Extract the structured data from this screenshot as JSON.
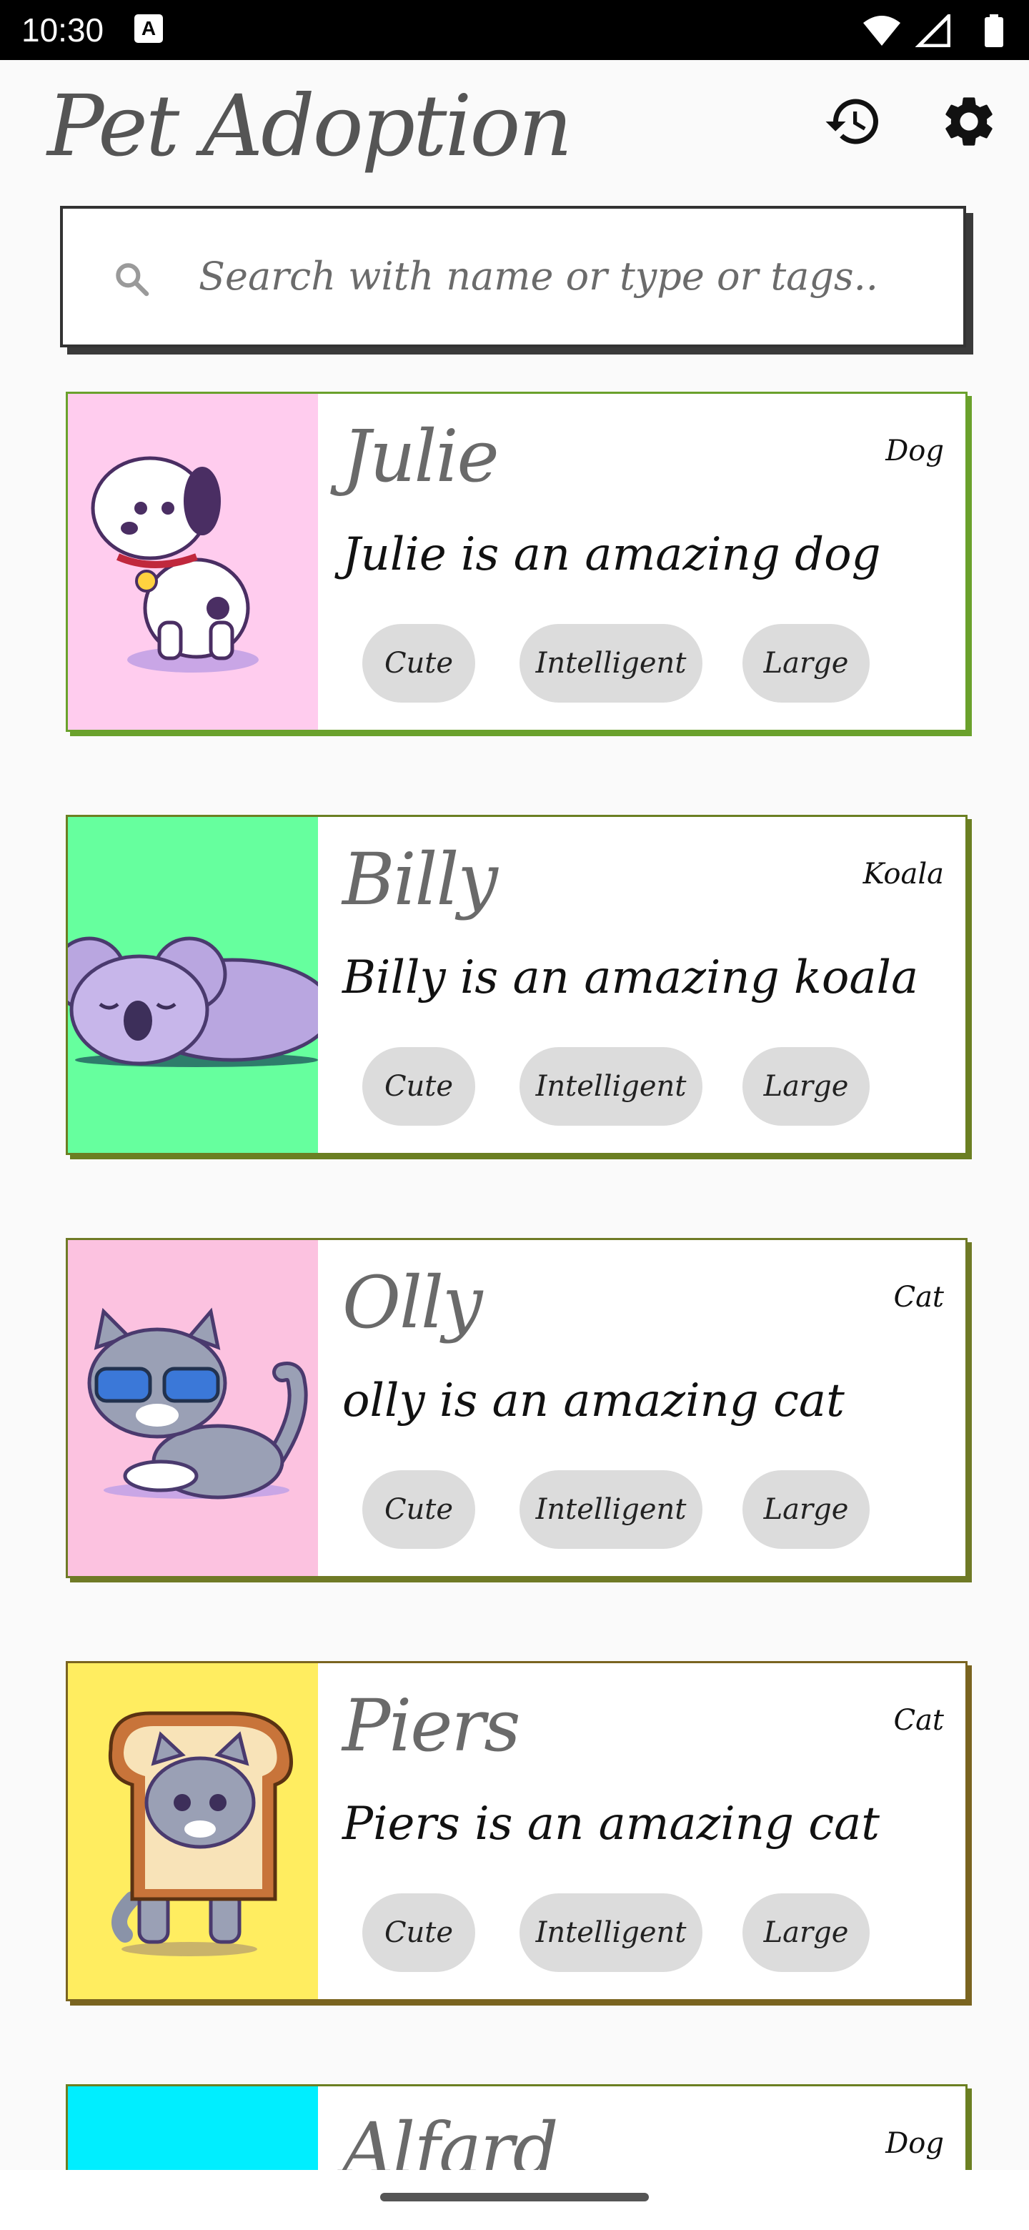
{
  "status_bar": {
    "time": "10:30",
    "indicator": "A"
  },
  "header": {
    "title": "Pet Adoption",
    "history_icon": "history-icon",
    "settings_icon": "gear-icon"
  },
  "search": {
    "placeholder": "Search with name or type or tags.."
  },
  "pets": [
    {
      "name": "Julie",
      "type": "Dog",
      "description": "Julie is an amazing dog",
      "tags": [
        "Cute",
        "Intelligent",
        "Large"
      ],
      "image_bg": "#ffccee",
      "border": "#6aa12c"
    },
    {
      "name": "Billy",
      "type": "Koala",
      "description": "Billy is an amazing koala",
      "tags": [
        "Cute",
        "Intelligent",
        "Large"
      ],
      "image_bg": "#66ff9e",
      "border": "#6b7f22"
    },
    {
      "name": "Olly",
      "type": "Cat",
      "description": "olly is an amazing cat",
      "tags": [
        "Cute",
        "Intelligent",
        "Large"
      ],
      "image_bg": "#fcc2e0",
      "border": "#6f7a26"
    },
    {
      "name": "Piers",
      "type": "Cat",
      "description": "Piers is an amazing cat",
      "tags": [
        "Cute",
        "Intelligent",
        "Large"
      ],
      "image_bg": "#ffed60",
      "border": "#7a6420"
    },
    {
      "name": "Alfard",
      "type": "Dog",
      "description": "",
      "tags": [],
      "image_bg": "#00eeff",
      "border": "#6b7f22"
    }
  ]
}
